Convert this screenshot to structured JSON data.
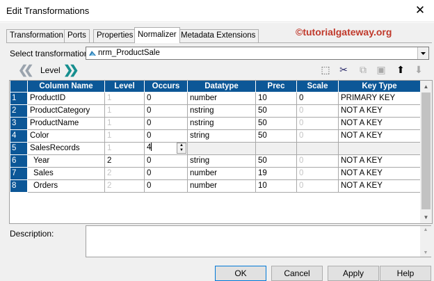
{
  "window": {
    "title": "Edit Transformations",
    "close_glyph": "✕"
  },
  "tabs": [
    {
      "label": "Transformation",
      "active": false
    },
    {
      "label": "Ports",
      "active": false
    },
    {
      "label": "Properties",
      "active": false
    },
    {
      "label": "Normalizer",
      "active": true
    },
    {
      "label": "Metadata Extensions",
      "active": false
    }
  ],
  "watermark": "©tutorialgateway.org",
  "select_transformation": {
    "label": "Select transformation:",
    "value": "nrm_ProductSale",
    "icon": "normalizer-transformation-icon"
  },
  "level_nav": {
    "label": "Level",
    "prev_glyph": "❮❮",
    "next_glyph": "❯❯"
  },
  "toolbar": {
    "new": {
      "icon": "new-row-icon",
      "glyph": "⬚"
    },
    "cut": {
      "icon": "scissors-icon",
      "glyph": "✂"
    },
    "copy": {
      "icon": "copy-icon",
      "glyph": "⧉"
    },
    "paste": {
      "icon": "paste-icon",
      "glyph": "▣"
    },
    "up": {
      "icon": "arrow-up-icon",
      "glyph": "⬆"
    },
    "down": {
      "icon": "arrow-down-icon",
      "glyph": "⬇"
    }
  },
  "grid": {
    "columns": [
      "Column Name",
      "Level",
      "Occurs",
      "Datatype",
      "Prec",
      "Scale",
      "Key Type"
    ],
    "rows": [
      {
        "n": "1",
        "name": "ProductID",
        "level": "1",
        "occurs": "0",
        "datatype": "number",
        "prec": "10",
        "scale": "0",
        "key": "PRIMARY KEY"
      },
      {
        "n": "2",
        "name": "ProductCategory",
        "level": "1",
        "occurs": "0",
        "datatype": "nstring",
        "prec": "50",
        "scale": "0",
        "key": "NOT A KEY"
      },
      {
        "n": "3",
        "name": "ProductName",
        "level": "1",
        "occurs": "0",
        "datatype": "nstring",
        "prec": "50",
        "scale": "0",
        "key": "NOT A KEY"
      },
      {
        "n": "4",
        "name": "Color",
        "level": "1",
        "occurs": "0",
        "datatype": "string",
        "prec": "50",
        "scale": "0",
        "key": "NOT A KEY"
      },
      {
        "n": "5",
        "name": "SalesRecords",
        "level": "1",
        "occurs": "4",
        "datatype": "",
        "prec": "",
        "scale": "",
        "key": ""
      },
      {
        "n": "6",
        "name": "Year",
        "level": "2",
        "occurs": "0",
        "datatype": "string",
        "prec": "50",
        "scale": "0",
        "key": "NOT A KEY"
      },
      {
        "n": "7",
        "name": "Sales",
        "level": "2",
        "occurs": "0",
        "datatype": "number",
        "prec": "19",
        "scale": "0",
        "key": "NOT A KEY"
      },
      {
        "n": "8",
        "name": "Orders",
        "level": "2",
        "occurs": "0",
        "datatype": "number",
        "prec": "10",
        "scale": "0",
        "key": "NOT A KEY"
      }
    ]
  },
  "description": {
    "label": "Description:",
    "value": ""
  },
  "buttons": {
    "ok": "OK",
    "cancel": "Cancel",
    "apply": "Apply",
    "help": "Help"
  },
  "colors": {
    "header_blue": "#0c5797",
    "watermark_red": "#c0392b",
    "nav_teal": "#178f8f"
  }
}
